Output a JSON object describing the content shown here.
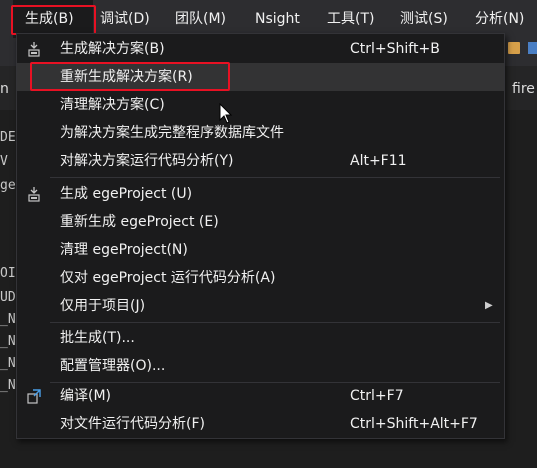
{
  "menubar": {
    "items": [
      {
        "label": "生成(B)"
      },
      {
        "label": "调试(D)"
      },
      {
        "label": "团队(M)"
      },
      {
        "label": "Nsight"
      },
      {
        "label": "工具(T)"
      },
      {
        "label": "测试(S)"
      },
      {
        "label": "分析(N)"
      }
    ]
  },
  "background": {
    "tab_left": "n",
    "tab_right": "fire",
    "left_lines": [
      "DE",
      "V",
      "ge",
      "",
      "",
      "",
      "OI",
      "UD",
      "_N",
      "_N",
      "_N",
      "_N"
    ]
  },
  "menu": {
    "items": [
      {
        "label": "生成解决方案(B)",
        "shortcut": "Ctrl+Shift+B",
        "icon": "build-icon"
      },
      {
        "label": "重新生成解决方案(R)",
        "shortcut": ""
      },
      {
        "label": "清理解决方案(C)",
        "shortcut": ""
      },
      {
        "label": "为解决方案生成完整程序数据库文件",
        "shortcut": ""
      },
      {
        "label": "对解决方案运行代码分析(Y)",
        "shortcut": "Alt+F11"
      },
      {
        "label": "生成 egeProject (U)",
        "shortcut": "",
        "icon": "build-icon"
      },
      {
        "label": "重新生成 egeProject (E)",
        "shortcut": ""
      },
      {
        "label": "清理 egeProject(N)",
        "shortcut": ""
      },
      {
        "label": "仅对 egeProject 运行代码分析(A)",
        "shortcut": ""
      },
      {
        "label": "仅用于项目(J)",
        "shortcut": "",
        "submenu": true
      },
      {
        "label": "批生成(T)...",
        "shortcut": ""
      },
      {
        "label": "配置管理器(O)...",
        "shortcut": ""
      },
      {
        "label": "编译(M)",
        "shortcut": "Ctrl+F7",
        "icon": "compile-icon"
      },
      {
        "label": "对文件运行代码分析(F)",
        "shortcut": "Ctrl+Shift+Alt+F7"
      }
    ]
  },
  "colors": {
    "highlight_box": "#e81123",
    "menu_bg": "#1b1b1c",
    "hover_bg": "#333334",
    "text": "#f1f1f1"
  }
}
